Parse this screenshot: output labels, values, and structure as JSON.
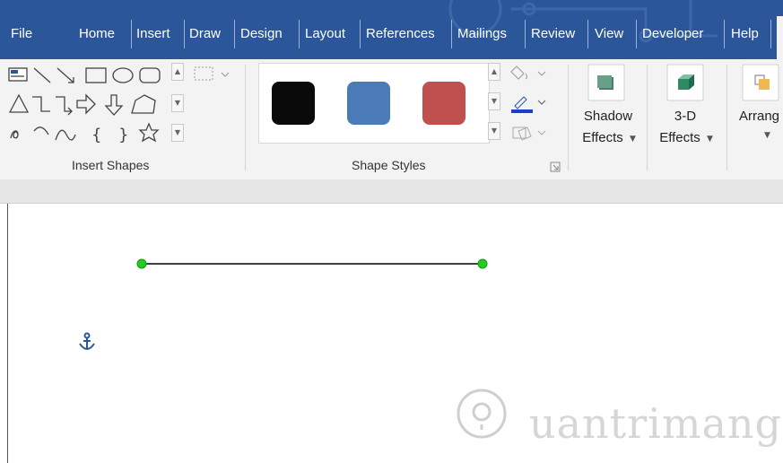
{
  "tabs": [
    {
      "label": "File"
    },
    {
      "label": "Home"
    },
    {
      "label": "Insert"
    },
    {
      "label": "Draw"
    },
    {
      "label": "Design"
    },
    {
      "label": "Layout"
    },
    {
      "label": "References"
    },
    {
      "label": "Mailings"
    },
    {
      "label": "Review"
    },
    {
      "label": "View"
    },
    {
      "label": "Developer"
    },
    {
      "label": "Help"
    }
  ],
  "ribbon": {
    "groups": {
      "insert_shapes": "Insert Shapes",
      "shape_styles": "Shape Styles"
    },
    "buttons": {
      "shadow_line1": "Shadow",
      "shadow_line2": "Effects",
      "threed_line1": "3-D",
      "threed_line2": "Effects",
      "arrange": "Arrang"
    },
    "style_swatches": [
      {
        "name": "black",
        "color": "#0a0a0a"
      },
      {
        "name": "blue",
        "color": "#4a7ab8"
      },
      {
        "name": "red",
        "color": "#c0504d"
      }
    ],
    "colors": {
      "tab_bar": "#2b579a",
      "ribbon_bg": "#f3f3f3",
      "selection_handle": "#22cc22",
      "anchor": "#2b579a"
    }
  },
  "watermark": "uantrimang"
}
